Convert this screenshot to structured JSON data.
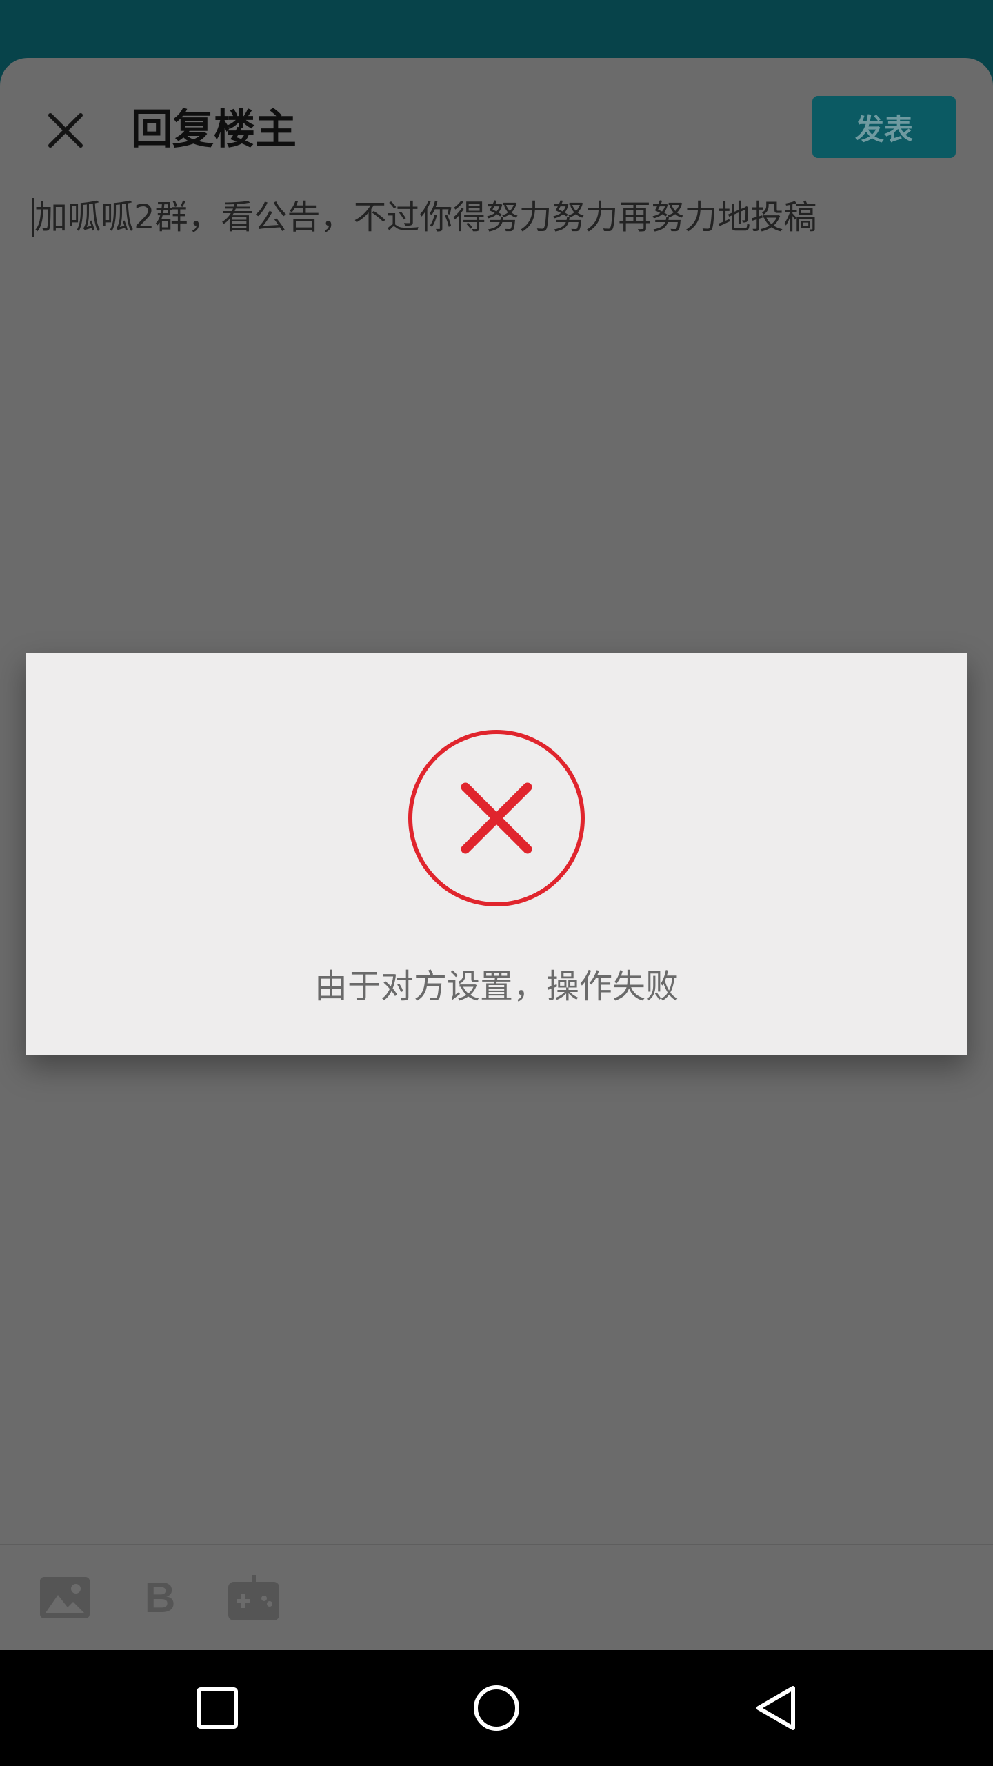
{
  "header": {
    "title": "回复楼主",
    "publish_label": "发表",
    "close_icon": "close-icon"
  },
  "editor": {
    "content": "加呱呱2群，看公告，不过你得努力努力再努力地投稿"
  },
  "toolbar": {
    "items": [
      {
        "icon": "image-icon"
      },
      {
        "label": "B",
        "icon": "bold-icon"
      },
      {
        "icon": "gamepad-icon"
      }
    ]
  },
  "dialog": {
    "icon": "error-icon",
    "message": "由于对方设置，操作失败"
  },
  "navigation": {
    "items": [
      "recent-apps-icon",
      "home-icon",
      "back-icon"
    ]
  },
  "colors": {
    "status_bar": "#07434a",
    "publish_button": "#0b5a63",
    "error_red": "#e0252d",
    "overlay": "#6b6b6b",
    "dialog_bg": "#eeeded"
  }
}
